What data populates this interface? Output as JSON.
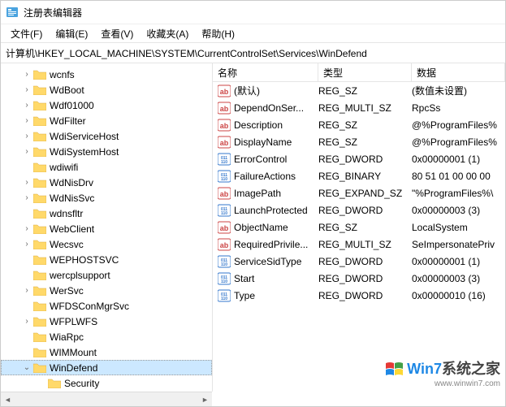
{
  "title": "注册表编辑器",
  "menu": [
    "文件(F)",
    "编辑(E)",
    "查看(V)",
    "收藏夹(A)",
    "帮助(H)"
  ],
  "path": "计算机\\HKEY_LOCAL_MACHINE\\SYSTEM\\CurrentControlSet\\Services\\WinDefend",
  "columns": {
    "name": "名称",
    "type": "类型",
    "data": "数据"
  },
  "tree": [
    {
      "label": "wcnfs",
      "depth": 1,
      "exp": ">"
    },
    {
      "label": "WdBoot",
      "depth": 1,
      "exp": ">"
    },
    {
      "label": "Wdf01000",
      "depth": 1,
      "exp": ">"
    },
    {
      "label": "WdFilter",
      "depth": 1,
      "exp": ">"
    },
    {
      "label": "WdiServiceHost",
      "depth": 1,
      "exp": ">"
    },
    {
      "label": "WdiSystemHost",
      "depth": 1,
      "exp": ">"
    },
    {
      "label": "wdiwifi",
      "depth": 1,
      "exp": ""
    },
    {
      "label": "WdNisDrv",
      "depth": 1,
      "exp": ">"
    },
    {
      "label": "WdNisSvc",
      "depth": 1,
      "exp": ">"
    },
    {
      "label": "wdnsfltr",
      "depth": 1,
      "exp": ""
    },
    {
      "label": "WebClient",
      "depth": 1,
      "exp": ">"
    },
    {
      "label": "Wecsvc",
      "depth": 1,
      "exp": ">"
    },
    {
      "label": "WEPHOSTSVC",
      "depth": 1,
      "exp": ""
    },
    {
      "label": "wercplsupport",
      "depth": 1,
      "exp": ""
    },
    {
      "label": "WerSvc",
      "depth": 1,
      "exp": ">"
    },
    {
      "label": "WFDSConMgrSvc",
      "depth": 1,
      "exp": ""
    },
    {
      "label": "WFPLWFS",
      "depth": 1,
      "exp": ">"
    },
    {
      "label": "WiaRpc",
      "depth": 1,
      "exp": ""
    },
    {
      "label": "WIMMount",
      "depth": 1,
      "exp": ""
    },
    {
      "label": "WinDefend",
      "depth": 1,
      "exp": "v",
      "sel": true
    },
    {
      "label": "Security",
      "depth": 2,
      "exp": ""
    }
  ],
  "values": [
    {
      "name": "(默认)",
      "type": "REG_SZ",
      "data": "(数值未设置)",
      "icon": "str"
    },
    {
      "name": "DependOnSer...",
      "type": "REG_MULTI_SZ",
      "data": "RpcSs",
      "icon": "str"
    },
    {
      "name": "Description",
      "type": "REG_SZ",
      "data": "@%ProgramFiles%",
      "icon": "str"
    },
    {
      "name": "DisplayName",
      "type": "REG_SZ",
      "data": "@%ProgramFiles%",
      "icon": "str"
    },
    {
      "name": "ErrorControl",
      "type": "REG_DWORD",
      "data": "0x00000001 (1)",
      "icon": "bin"
    },
    {
      "name": "FailureActions",
      "type": "REG_BINARY",
      "data": "80 51 01 00 00 00",
      "icon": "bin"
    },
    {
      "name": "ImagePath",
      "type": "REG_EXPAND_SZ",
      "data": "\"%ProgramFiles%\\",
      "icon": "str"
    },
    {
      "name": "LaunchProtected",
      "type": "REG_DWORD",
      "data": "0x00000003 (3)",
      "icon": "bin"
    },
    {
      "name": "ObjectName",
      "type": "REG_SZ",
      "data": "LocalSystem",
      "icon": "str"
    },
    {
      "name": "RequiredPrivile...",
      "type": "REG_MULTI_SZ",
      "data": "SeImpersonatePriv",
      "icon": "str"
    },
    {
      "name": "ServiceSidType",
      "type": "REG_DWORD",
      "data": "0x00000001 (1)",
      "icon": "bin"
    },
    {
      "name": "Start",
      "type": "REG_DWORD",
      "data": "0x00000003 (3)",
      "icon": "bin"
    },
    {
      "name": "Type",
      "type": "REG_DWORD",
      "data": "0x00000010 (16)",
      "icon": "bin"
    }
  ],
  "watermark": {
    "brand": "Win7",
    "text": "系统之家",
    "url": "www.winwin7.com"
  }
}
